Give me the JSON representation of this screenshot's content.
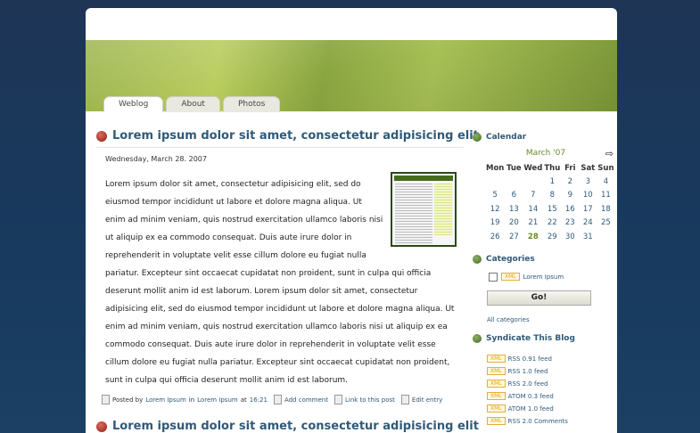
{
  "nav": {
    "tabs": [
      "Weblog",
      "About",
      "Photos"
    ],
    "active": "Weblog"
  },
  "post": {
    "title": "Lorem ipsum dolor sit amet, consectetur adipisicing elit",
    "date": "Wednesday, March 28. 2007",
    "body": "Lorem ipsum dolor sit amet, consectetur adipisicing elit, sed do eiusmod tempor incididunt ut labore et dolore magna aliqua. Ut enim ad minim veniam, quis nostrud exercitation ullamco laboris nisi ut aliquip ex ea commodo consequat. Duis aute irure dolor in reprehenderit in voluptate velit esse cillum dolore eu fugiat nulla pariatur. Excepteur sint occaecat cupidatat non proident, sunt in culpa qui officia deserunt mollit anim id est laborum. Lorem ipsum dolor sit amet, consectetur adipisicing elit, sed do eiusmod tempor incididunt ut labore et dolore magna aliqua. Ut enim ad minim veniam, quis nostrud exercitation ullamco laboris nisi ut aliquip ex ea commodo consequat. Duis aute irure dolor in reprehenderit in voluptate velit esse cillum dolore eu fugiat nulla pariatur. Excepteur sint occaecat cupidatat non proident, sunt in culpa qui officia deserunt mollit anim id est laborum.",
    "meta": {
      "posted_by": "Posted by",
      "author": "Lorem Ipsum",
      "in": "in",
      "category": "Lorem Ipsum",
      "at": "at",
      "time": "16:21",
      "add_comment": "Add comment",
      "link": "Link to this post",
      "edit": "Edit entry"
    }
  },
  "post2": {
    "title": "Lorem ipsum dolor sit amet, consectetur adipisicing elit"
  },
  "sidebar": {
    "calendar": {
      "heading": "Calendar",
      "month": "March '07",
      "arrow": "⇨",
      "days": [
        "Mon",
        "Tue",
        "Wed",
        "Thu",
        "Fri",
        "Sat",
        "Sun"
      ],
      "weeks": [
        [
          "",
          "",
          "",
          "1",
          "2",
          "3",
          "4"
        ],
        [
          "5",
          "6",
          "7",
          "8",
          "9",
          "10",
          "11"
        ],
        [
          "12",
          "13",
          "14",
          "15",
          "16",
          "17",
          "18"
        ],
        [
          "19",
          "20",
          "21",
          "22",
          "23",
          "24",
          "25"
        ],
        [
          "26",
          "27",
          "28",
          "29",
          "30",
          "31",
          ""
        ]
      ],
      "today": "28"
    },
    "categories": {
      "heading": "Categories",
      "xml": "XML",
      "item": "Lorem Ipsum",
      "go": "Go!",
      "all": "All categories"
    },
    "syndicate": {
      "heading": "Syndicate This Blog",
      "xml": "XML",
      "feeds": [
        "RSS 0.91 feed",
        "RSS 1.0 feed",
        "RSS 2.0 feed",
        "ATOM 0.3 feed",
        "ATOM 1.0 feed",
        "RSS 2.0 Comments"
      ]
    }
  }
}
